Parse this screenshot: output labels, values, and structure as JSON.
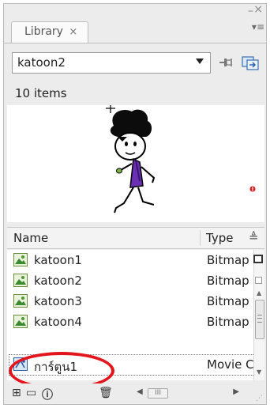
{
  "panel": {
    "tab_label": "Library",
    "tab_close": "×",
    "window_min": "–",
    "window_close": "×",
    "menu_icon": "▾≡"
  },
  "library_select": {
    "value": "katoon2"
  },
  "item_count": "10 items",
  "list_header": {
    "name": "Name",
    "type": "Type",
    "sort_icon": "≜"
  },
  "items": [
    {
      "name": "katoon1",
      "type": "Bitmap",
      "icon": "bitmap-icon"
    },
    {
      "name": "katoon2",
      "type": "Bitmap",
      "icon": "bitmap-icon"
    },
    {
      "name": "katoon3",
      "type": "Bitmap",
      "icon": "bitmap-icon"
    },
    {
      "name": "katoon4",
      "type": "Bitmap",
      "icon": "bitmap-icon"
    },
    {
      "name": "การ์ตูน1",
      "type": "Movie Clip",
      "icon": "movieclip-icon"
    }
  ],
  "footer": {
    "hscroll_thumb": "III"
  },
  "colors": {
    "annotation": "#e3141b",
    "shirt": "#6a2fb3",
    "panel_bg": "#ececec"
  }
}
